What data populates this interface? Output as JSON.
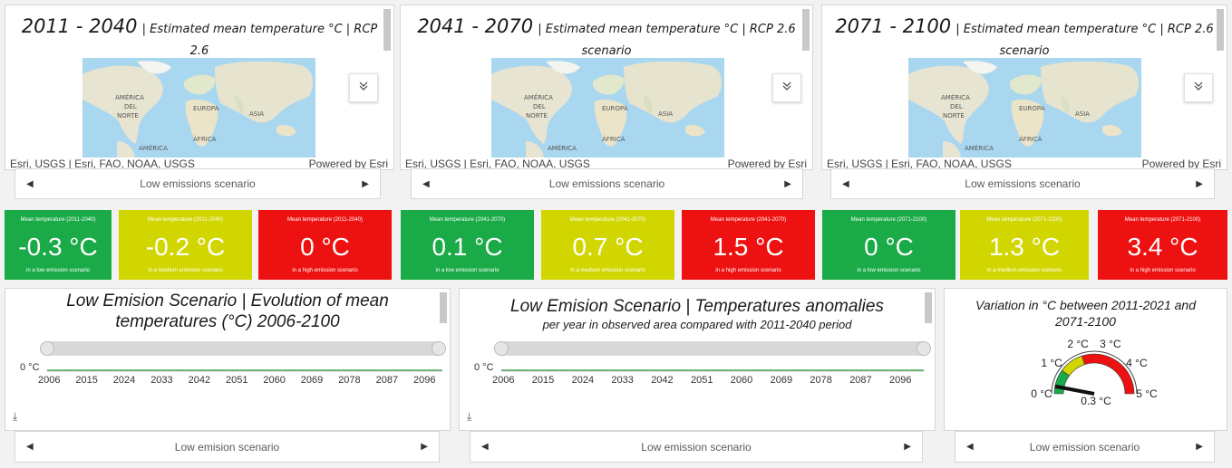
{
  "maps": [
    {
      "period": "2011 - 2040",
      "subtitle_a": "| Estimated mean temperature °C | RCP 2.6",
      "subtitle_b": "scenario",
      "attribution": "Esri, USGS | Esri, FAO, NOAA, USGS",
      "powered": "Powered by Esri",
      "nav_label": "Low emissions scenario"
    },
    {
      "period": "2041 - 2070",
      "subtitle_a": "| Estimated mean temperature °C | RCP 2.6",
      "subtitle_b": "scenario",
      "attribution": "Esri, USGS | Esri, FAO, NOAA, USGS",
      "powered": "Powered by Esri",
      "nav_label": "Low emissions scenario"
    },
    {
      "period": "2071 - 2100",
      "subtitle_a": "| Estimated mean temperature °C | RCP 2.6",
      "subtitle_b": "scenario",
      "attribution": "Esri, USGS | Esri, FAO, NOAA, USGS",
      "powered": "Powered by Esri",
      "nav_label": "Low emissions scenario"
    }
  ],
  "map_labels": {
    "na1": "AMÉRICA",
    "na2": "DEL",
    "na3": "NORTE",
    "eu": "EUROPA",
    "as": "ASIA",
    "af": "ÁFRICA",
    "sa": "AMÉRICA"
  },
  "indicators": [
    {
      "top": "Mean temperature (2011-2040)",
      "value": "-0.3 °C",
      "bottom": "in a low emission scenario",
      "color": "green"
    },
    {
      "top": "Mean temperature (2011-2040)",
      "value": "-0.2 °C",
      "bottom": "in a medium emission scenario",
      "color": "yellow"
    },
    {
      "top": "Mean temperature (2011-2040)",
      "value": "0 °C",
      "bottom": "in a high emission scenario",
      "color": "red"
    },
    {
      "top": "Mean temperature (2041-2070)",
      "value": "0.1 °C",
      "bottom": "in a low emission scenario",
      "color": "green"
    },
    {
      "top": "Mean temperature (2041-2070)",
      "value": "0.7 °C",
      "bottom": "in a medium emission scenario",
      "color": "yellow"
    },
    {
      "top": "Mean temperature (2041-2070)",
      "value": "1.5 °C",
      "bottom": "in a high emission scenario",
      "color": "red"
    },
    {
      "top": "Mean temperature (2071-2100)",
      "value": "0 °C",
      "bottom": "in a low emission scenario",
      "color": "green"
    },
    {
      "top": "Mean temperature (2071-2100)",
      "value": "1.3 °C",
      "bottom": "in a medium emission scenario",
      "color": "yellow"
    },
    {
      "top": "Mean temperature (2071-2100)",
      "value": "3.4 °C",
      "bottom": "in a high emission scenario",
      "color": "red"
    }
  ],
  "chart1": {
    "title_a": "Low Emision Scenario | Evolution of mean",
    "title_b": "temperatures (°C) 2006-2100",
    "ylabel": "0 °C",
    "nav_label": "Low emision scenario"
  },
  "chart2": {
    "title_a": "Low Emision Scenario | Temperatures anomalies",
    "title_b": "per year in observed area compared with 2011-2040 period",
    "ylabel": "0 °C",
    "nav_label": "Low emission scenario"
  },
  "gauge": {
    "title_a": "Variation in °C between 2011-2021 and",
    "title_b": "2071-2100",
    "labels": [
      "0 °C",
      "1 °C",
      "2 °C",
      "3 °C",
      "4 °C",
      "5 °C"
    ],
    "value_label": "0.3 °C",
    "value": 0.3,
    "nav_label": "Low emission scenario"
  },
  "chart_data": [
    {
      "type": "line",
      "title": "Low Emision Scenario | Evolution of mean temperatures (°C) 2006-2100",
      "x_ticks": [
        "2006",
        "2015",
        "2024",
        "2033",
        "2042",
        "2051",
        "2060",
        "2069",
        "2078",
        "2087",
        "2096"
      ],
      "y_ticks": [
        "0 °C"
      ],
      "series": [
        {
          "values": [
            0,
            0,
            0,
            0,
            0,
            0,
            0,
            0,
            0,
            0,
            0
          ]
        }
      ],
      "xlim": [
        2006,
        2100
      ]
    },
    {
      "type": "line",
      "title": "Low Emision Scenario | Temperatures anomalies per year in observed area compared with 2011-2040 period",
      "x_ticks": [
        "2006",
        "2015",
        "2024",
        "2033",
        "2042",
        "2051",
        "2060",
        "2069",
        "2078",
        "2087",
        "2096"
      ],
      "y_ticks": [
        "0 °C"
      ],
      "series": [
        {
          "values": [
            0,
            0,
            0,
            0,
            0,
            0,
            0,
            0,
            0,
            0,
            0
          ]
        }
      ],
      "xlim": [
        2006,
        2100
      ]
    }
  ],
  "colors": {
    "green": "#1aaa47",
    "yellow": "#d2d600",
    "red": "#ee1111",
    "line": "#2a9d3a"
  }
}
